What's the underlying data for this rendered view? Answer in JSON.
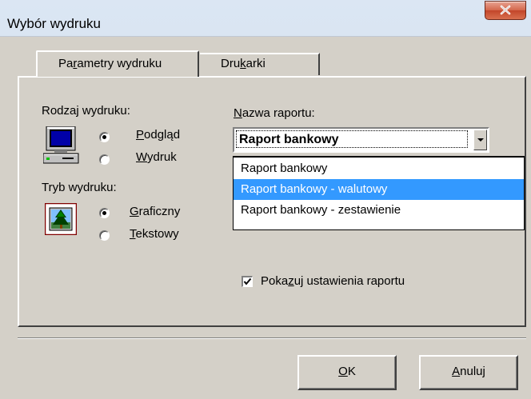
{
  "window": {
    "title": "Wybór wydruku",
    "close_icon": "close-icon"
  },
  "tabs": [
    {
      "pre": "Pa",
      "ul": "r",
      "post": "ametry wydruku",
      "active": true
    },
    {
      "pre": "Dru",
      "ul": "k",
      "post": "arki",
      "active": false
    }
  ],
  "print_type": {
    "label": "Rodzaj wydruku:",
    "icon": "computer-icon",
    "options": [
      {
        "ul": "P",
        "post": "odgląd",
        "checked": true
      },
      {
        "ul": "W",
        "post": "ydruk",
        "checked": false
      }
    ]
  },
  "print_mode": {
    "label": "Tryb wydruku:",
    "icon": "tree-image-icon",
    "options": [
      {
        "ul": "G",
        "post": "raficzny",
        "checked": true
      },
      {
        "ul": "T",
        "post": "ekstowy",
        "checked": false
      }
    ]
  },
  "report_name": {
    "label_ul": "N",
    "label_post": "azwa raportu:",
    "selected": "Raport bankowy",
    "options": [
      "Raport bankowy",
      "Raport bankowy - walutowy",
      "Raport bankowy - zestawienie"
    ],
    "highlighted_index": 1
  },
  "show_settings": {
    "pre": "Poka",
    "ul": "z",
    "post": "uj ustawienia raportu",
    "checked": true
  },
  "buttons": {
    "ok": {
      "ul": "O",
      "post": "K"
    },
    "cancel": {
      "ul": "A",
      "post": "nuluj"
    }
  },
  "colors": {
    "highlight": "#3399ff",
    "face": "#d4d0c8"
  }
}
